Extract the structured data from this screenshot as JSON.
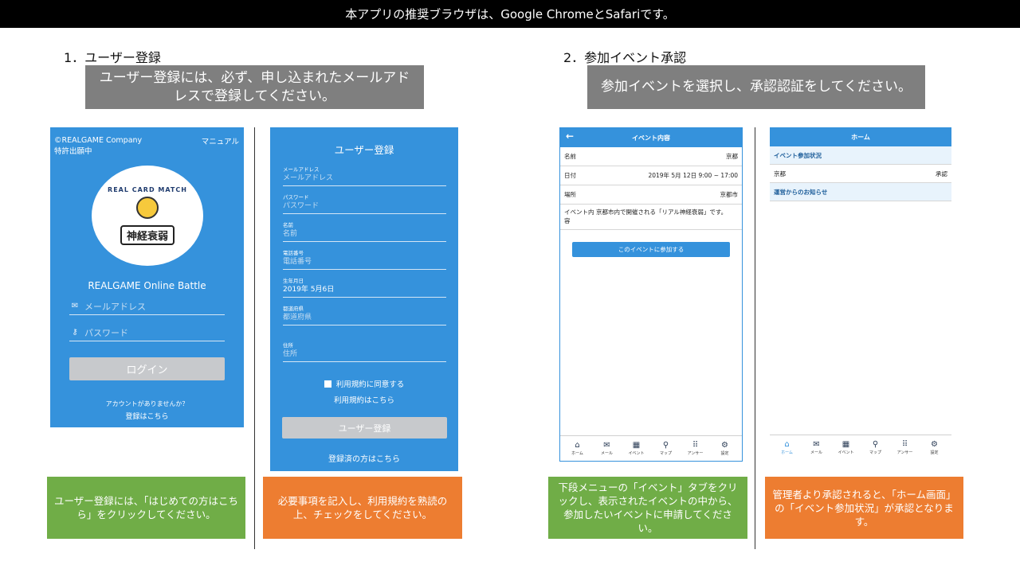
{
  "banner": {
    "text": "本アプリの推奨ブラウザは、Google ChromeとSafariです。"
  },
  "section1": {
    "title": "1．ユーザー登録",
    "note": "ユーザー登録には、必ず、申し込まれたメールアドレスで登録してください。"
  },
  "section2": {
    "title": "2．参加イベント承認",
    "note": "参加イベントを選択し、承認認証をしてください。"
  },
  "login": {
    "copyright": "©REALGAME Company",
    "patent": "特許出願中",
    "manual": "マニュアル",
    "logo_arc": "REAL CARD MATCH",
    "logo_main": "神経衰弱",
    "app_name": "REALGAME Online Battle",
    "email_placeholder": "メールアドレス",
    "password_placeholder": "パスワード",
    "login_button": "ログイン",
    "no_account": "アカウントがありませんか？",
    "register_link": "登録はこちら"
  },
  "register": {
    "title": "ユーザー登録",
    "fields": [
      {
        "label": "メールアドレス",
        "value": "メールアドレス"
      },
      {
        "label": "パスワード",
        "value": "パスワード"
      },
      {
        "label": "名前",
        "value": "名前"
      },
      {
        "label": "電話番号",
        "value": "電話番号"
      },
      {
        "label": "生年月日",
        "value": "2019年 5月6日"
      },
      {
        "label": "都道府県",
        "value": "都道府県"
      },
      {
        "label": "住所",
        "value": "住所"
      }
    ],
    "agree": "利用規約に同意する",
    "terms_link": "利用規約はこちら",
    "submit": "ユーザー登録",
    "registered_link": "登録済の方はこちら"
  },
  "event": {
    "header": "イベント内容",
    "rows": [
      {
        "label": "名前",
        "value": "京都"
      },
      {
        "label": "日付",
        "value": "2019年 5月 12日 9:00 ~ 17:00"
      },
      {
        "label": "場所",
        "value": "京都市"
      }
    ],
    "content_label": "イベント内容",
    "content_value": "京都市内で開催される「リアル神経衰弱」です。",
    "join_button": "このイベントに参加する"
  },
  "home": {
    "header": "ホーム",
    "status_title": "イベント参加状況",
    "status_name": "京都",
    "status_value": "承認",
    "notice_title": "運営からのお知らせ"
  },
  "tabs": [
    {
      "label": "ホーム",
      "icon": "home-icon",
      "glyph": "⌂"
    },
    {
      "label": "メール",
      "icon": "mail-icon",
      "glyph": "✉"
    },
    {
      "label": "イベント",
      "icon": "calendar-icon",
      "glyph": "▦"
    },
    {
      "label": "マップ",
      "icon": "map-pin-icon",
      "glyph": "⚲"
    },
    {
      "label": "アンサー",
      "icon": "grid-icon",
      "glyph": "⠿"
    },
    {
      "label": "設定",
      "icon": "gear-icon",
      "glyph": "⚙"
    }
  ],
  "captions": {
    "c1": "ユーザー登録には、「はじめての方はこちら」をクリックしてください。",
    "c2": "必要事項を記入し、利用規約を熟読の上、チェックをしてください。",
    "c3": "下段メニューの「イベント」タブをクリックし、表示されたイベントの中から、参加したいイベントに申請してください。",
    "c4": "管理者より承認されると、「ホーム画面」の「イベント参加状況」が承認となります。"
  },
  "colors": {
    "app_blue": "#3592dc",
    "green": "#70ad47",
    "orange": "#ed7d31",
    "gray": "#7f7f7f"
  }
}
